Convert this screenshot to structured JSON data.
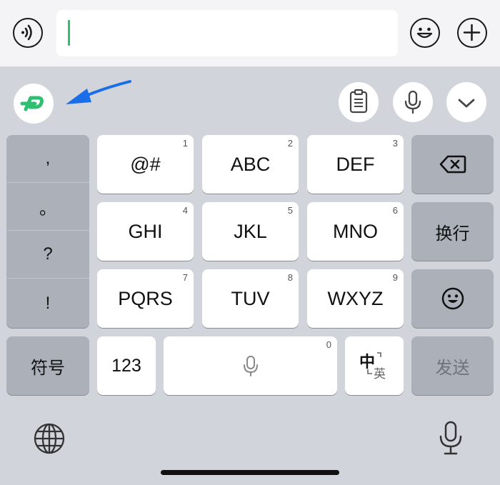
{
  "keyboard": {
    "punctuation": [
      ",",
      "。",
      "?",
      "!"
    ],
    "grid": [
      {
        "label": "@#",
        "num": "1"
      },
      {
        "label": "ABC",
        "num": "2"
      },
      {
        "label": "DEF",
        "num": "3"
      },
      {
        "label": "GHI",
        "num": "4"
      },
      {
        "label": "JKL",
        "num": "5"
      },
      {
        "label": "MNO",
        "num": "6"
      },
      {
        "label": "PQRS",
        "num": "7"
      },
      {
        "label": "TUV",
        "num": "8"
      },
      {
        "label": "WXYZ",
        "num": "9"
      }
    ],
    "newline_label": "换行",
    "symbols_label": "符号",
    "numbers_label": "123",
    "space_num": "0",
    "lang_zh": "中",
    "lang_en": "英",
    "send_label": "发送"
  },
  "colors": {
    "accent": "#2fbf71",
    "arrow": "#1a6fe8",
    "dark_key": "#abb0b9",
    "keyboard_bg": "#d1d4da"
  }
}
